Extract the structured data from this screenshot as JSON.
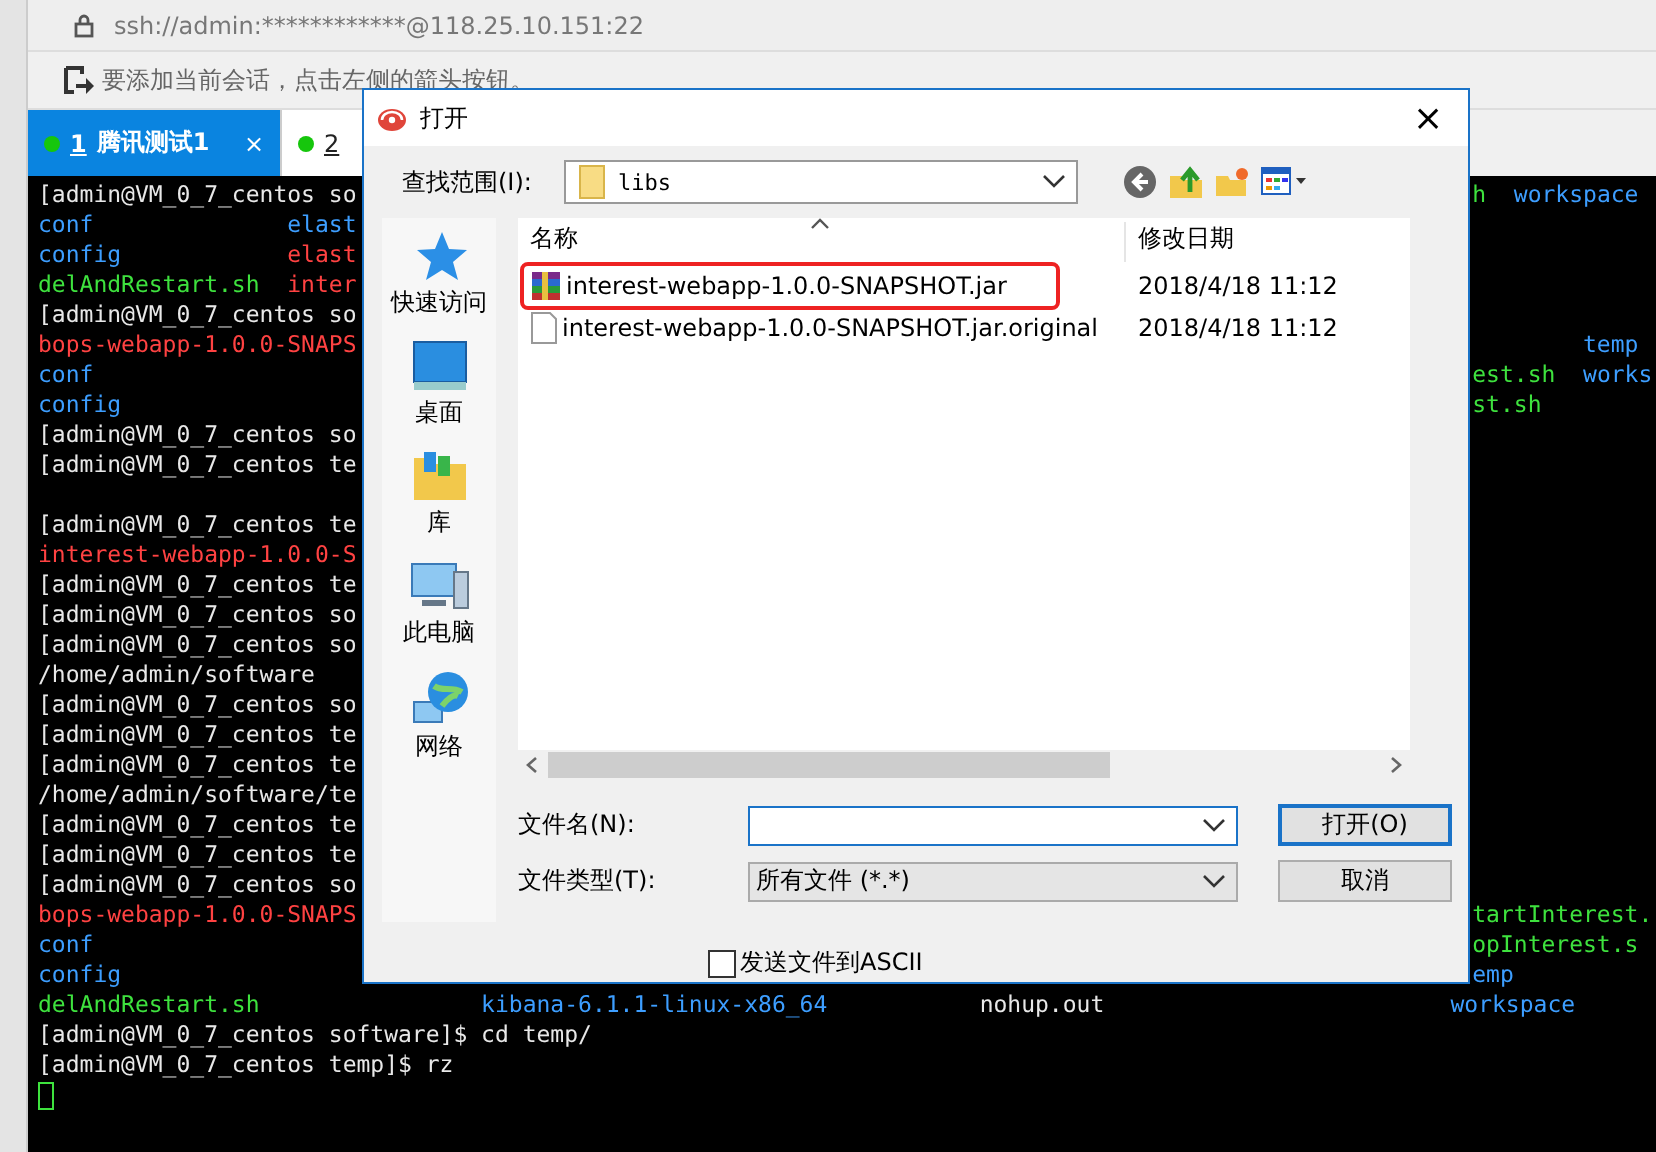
{
  "address_bar": {
    "text": "ssh://admin:************@118.25.10.151:22"
  },
  "hint_bar": {
    "text": "要添加当前会话，点击左侧的箭头按钮。"
  },
  "tabs": [
    {
      "number": "1",
      "label": "腾讯测试1",
      "close": "×",
      "selected": true
    },
    {
      "number": "2",
      "selected": false
    }
  ],
  "terminal": {
    "lines": [
      {
        "left": [
          {
            "text": "[admin@VM_0_7_centos so",
            "kind": "text"
          }
        ],
        "right": [
          {
            "text": "h",
            "kind": "exec"
          },
          {
            "text": "  workspace",
            "kind": "dir"
          }
        ]
      },
      {
        "left": [
          {
            "text": "conf",
            "kind": "dir"
          },
          {
            "text": "              elast",
            "kind": "dir"
          }
        ]
      },
      {
        "left": [
          {
            "text": "config",
            "kind": "dir"
          },
          {
            "text": "            elast",
            "kind": "archive"
          }
        ]
      },
      {
        "left": [
          {
            "text": "delAndRestart.sh",
            "kind": "exec"
          },
          {
            "text": "  inter",
            "kind": "archive"
          }
        ]
      },
      {
        "left": [
          {
            "text": "[admin@VM_0_7_centos so",
            "kind": "text"
          }
        ]
      },
      {
        "left": [
          {
            "text": "bops-webapp-1.0.0-SNAPS",
            "kind": "archive"
          }
        ],
        "right": [
          {
            "text": "        temp",
            "kind": "dir"
          }
        ]
      },
      {
        "left": [
          {
            "text": "conf",
            "kind": "dir"
          }
        ],
        "right": [
          {
            "text": "est.sh",
            "kind": "exec"
          },
          {
            "text": "  works",
            "kind": "dir"
          }
        ]
      },
      {
        "left": [
          {
            "text": "config",
            "kind": "dir"
          }
        ],
        "right": [
          {
            "text": "st.sh",
            "kind": "exec"
          }
        ]
      },
      {
        "left": [
          {
            "text": "[admin@VM_0_7_centos so",
            "kind": "text"
          }
        ]
      },
      {
        "left": [
          {
            "text": "[admin@VM_0_7_centos te",
            "kind": "text"
          }
        ]
      },
      {
        "cursor": false
      },
      {
        "left": [
          {
            "text": "[admin@VM_0_7_centos te",
            "kind": "text"
          }
        ]
      },
      {
        "left": [
          {
            "text": "interest-webapp-1.0.0-S",
            "kind": "archive"
          }
        ]
      },
      {
        "left": [
          {
            "text": "[admin@VM_0_7_centos te",
            "kind": "text"
          }
        ]
      },
      {
        "left": [
          {
            "text": "[admin@VM_0_7_centos so",
            "kind": "text"
          }
        ]
      },
      {
        "left": [
          {
            "text": "[admin@VM_0_7_centos so",
            "kind": "text"
          }
        ]
      },
      {
        "left": [
          {
            "text": "/home/admin/software",
            "kind": "text"
          }
        ]
      },
      {
        "left": [
          {
            "text": "[admin@VM_0_7_centos so",
            "kind": "text"
          }
        ]
      },
      {
        "left": [
          {
            "text": "[admin@VM_0_7_centos te",
            "kind": "text"
          }
        ]
      },
      {
        "left": [
          {
            "text": "[admin@VM_0_7_centos te",
            "kind": "text"
          }
        ]
      },
      {
        "left": [
          {
            "text": "/home/admin/software/te",
            "kind": "text"
          }
        ]
      },
      {
        "left": [
          {
            "text": "[admin@VM_0_7_centos te",
            "kind": "text"
          }
        ]
      },
      {
        "left": [
          {
            "text": "[admin@VM_0_7_centos te",
            "kind": "text"
          }
        ]
      },
      {
        "left": [
          {
            "text": "[admin@VM_0_7_centos so",
            "kind": "text"
          }
        ]
      },
      {
        "left": [
          {
            "text": "bops-webapp-1.0.0-SNAPS",
            "kind": "archive"
          }
        ],
        "right": [
          {
            "text": "tartInterest.",
            "kind": "exec"
          }
        ]
      },
      {
        "left": [
          {
            "text": "conf",
            "kind": "dir"
          }
        ],
        "right": [
          {
            "text": "opInterest.s",
            "kind": "exec"
          }
        ]
      },
      {
        "left": [
          {
            "text": "config",
            "kind": "dir"
          }
        ],
        "right": [
          {
            "text": "emp",
            "kind": "dir"
          }
        ]
      },
      {
        "left": [
          {
            "text": "delAndRestart.sh",
            "kind": "exec"
          },
          {
            "text": "                kibana-6.1.1-linux-x86_64",
            "kind": "dir"
          },
          {
            "text": "           nohup.out",
            "kind": "text"
          },
          {
            "text": "                         workspace",
            "kind": "dir"
          }
        ]
      },
      {
        "left": [
          {
            "text": "[admin@VM_0_7_centos software]$ cd temp/",
            "kind": "text"
          }
        ]
      },
      {
        "left": [
          {
            "text": "[admin@VM_0_7_centos temp]$ rz",
            "kind": "text"
          }
        ]
      },
      {
        "cursor": true
      }
    ]
  },
  "dialog": {
    "title": "打开",
    "close": "×",
    "look_in": {
      "label": "查找范围(I):",
      "value": "libs"
    },
    "places": [
      {
        "label": "快速访问",
        "kind": "quick"
      },
      {
        "label": "桌面",
        "kind": "desktop"
      },
      {
        "label": "库",
        "kind": "library"
      },
      {
        "label": "此电脑",
        "kind": "computer"
      },
      {
        "label": "网络",
        "kind": "network"
      }
    ],
    "file_list": {
      "columns": [
        "名称",
        "修改日期"
      ],
      "rows": [
        {
          "name": "interest-webapp-1.0.0-SNAPSHOT.jar",
          "date": "2018/4/18 11:12",
          "kind": "archive",
          "annotated": true
        },
        {
          "name": "interest-webapp-1.0.0-SNAPSHOT.jar.original",
          "date": "2018/4/18 11:12",
          "kind": "file",
          "annotated": false
        }
      ]
    },
    "file_name": {
      "label": "文件名(N):"
    },
    "file_type": {
      "label": "文件类型(T):",
      "value": "所有文件 (*.*)"
    },
    "buttons": [
      "打开(O)",
      "取消"
    ],
    "ascii_checkbox": {
      "label": "发送文件到ASCII",
      "checked": false
    }
  }
}
